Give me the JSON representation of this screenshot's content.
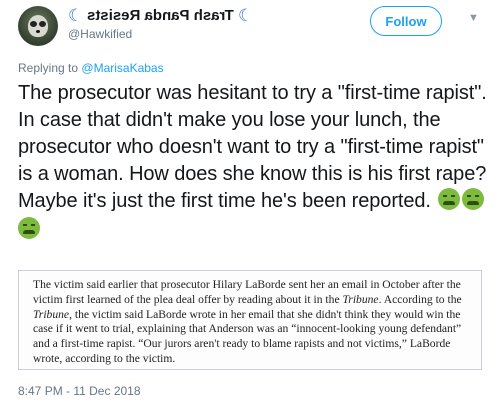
{
  "account": {
    "display_name": "Trash Panda Resists",
    "handle": "@Hawkified"
  },
  "follow_label": "Follow",
  "reply": {
    "prefix": "Replying to",
    "mention": "@MarisaKabas"
  },
  "tweet": {
    "text": "The prosecutor was hesitant to try a \"first-time rapist\". In case that didn't make you lose your lunch, the prosecutor who doesn't want to try a \"first-time rapist\" is a woman. How does she know this is his first rape?Maybe it's just the first time he's been reported.",
    "emoji": [
      "nauseated-face",
      "nauseated-face",
      "nauseated-face"
    ]
  },
  "quote": {
    "part1": "The victim said earlier that prosecutor Hilary LaBorde sent her an email in October after the victim first learned of the plea deal offer by reading about it in the ",
    "publication_1": "Tribune",
    "part2": ". According to the ",
    "publication_2": "Tribune",
    "part3": ", the victim said LaBorde wrote in her email that she didn't think they would win the case if it went to trial, explaining that Anderson was an “innocent-looking young defendant” and a first-time rapist. “Our jurors aren't ready to blame rapists and not victims,” LaBorde wrote, according to the victim."
  },
  "timestamp": "8:47 PM - 11 Dec 2018"
}
